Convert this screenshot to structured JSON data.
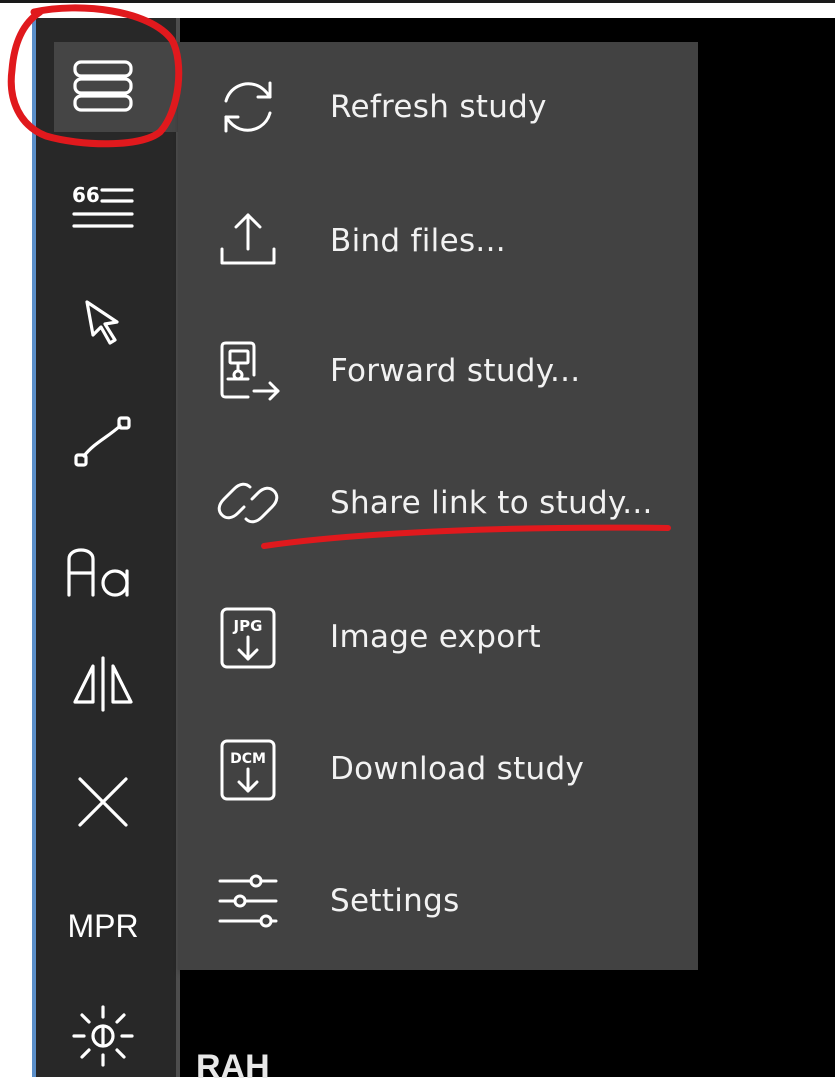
{
  "toolbar": {
    "tools": [
      {
        "name": "menu-icon"
      },
      {
        "name": "annotation-list-icon"
      },
      {
        "name": "pointer-icon"
      },
      {
        "name": "line-measure-icon"
      },
      {
        "name": "text-annotation-icon"
      },
      {
        "name": "flip-icon"
      },
      {
        "name": "close-icon"
      },
      {
        "label": "MPR"
      },
      {
        "name": "window-level-icon"
      }
    ]
  },
  "menu": {
    "items": [
      {
        "label": "Refresh study",
        "icon": "refresh-icon"
      },
      {
        "label": "Bind files...",
        "icon": "upload-icon"
      },
      {
        "label": "Forward study...",
        "icon": "forward-icon"
      },
      {
        "label": "Share link to study...",
        "icon": "link-icon"
      },
      {
        "label": "Image export",
        "icon": "jpg-export-icon",
        "badge": "JPG"
      },
      {
        "label": "Download study",
        "icon": "dcm-download-icon",
        "badge": "DCM"
      },
      {
        "label": "Settings",
        "icon": "sliders-icon"
      }
    ]
  },
  "viewport": {
    "orientation_label": "RAH"
  },
  "annotations": {
    "highlight_color": "#e0191d"
  }
}
